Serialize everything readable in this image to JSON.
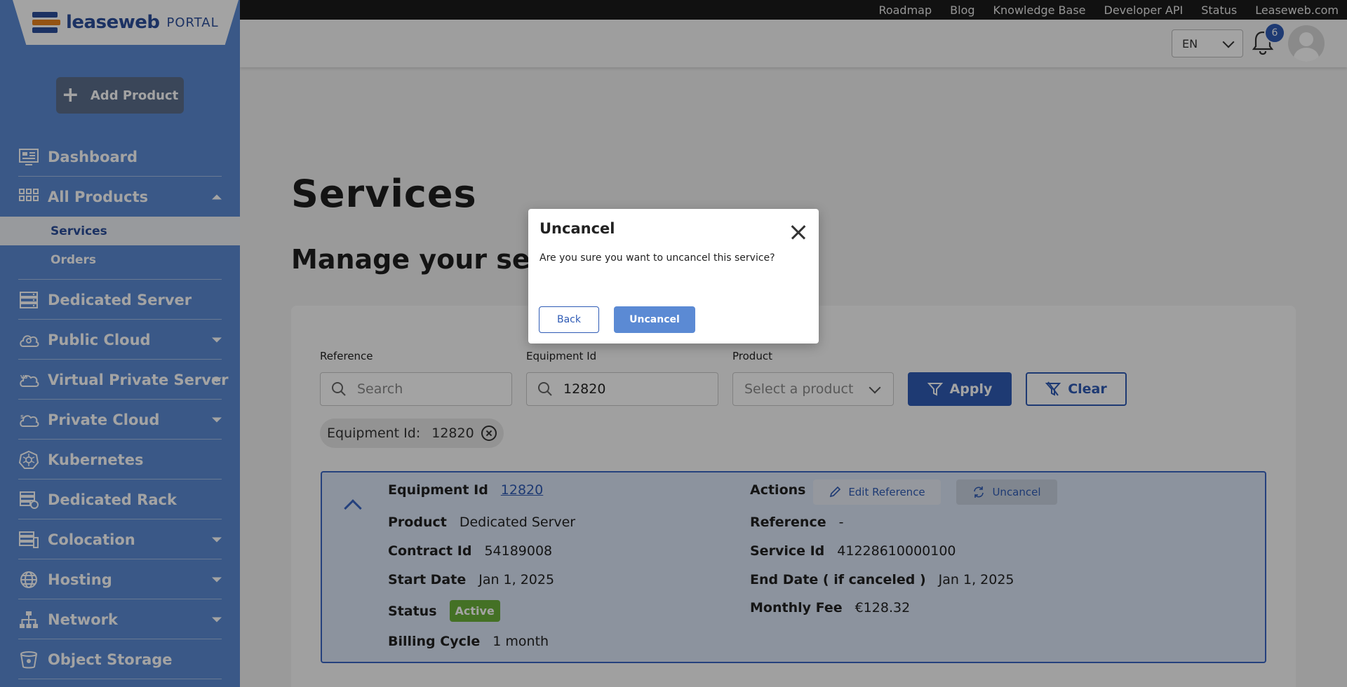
{
  "topnav": {
    "links": [
      "Roadmap",
      "Blog",
      "Knowledge Base",
      "Developer API",
      "Status",
      "Leaseweb.com"
    ]
  },
  "brand": {
    "name": "leaseweb",
    "portal": "PORTAL"
  },
  "sidebar": {
    "add_product": "Add Product",
    "items": [
      {
        "label": "Dashboard",
        "icon": "dashboard-icon"
      },
      {
        "label": "All Products",
        "icon": "grid-icon"
      },
      {
        "label": "Dedicated Server",
        "icon": "server-icon"
      },
      {
        "label": "Public Cloud",
        "icon": "cloud-user-icon"
      },
      {
        "label": "Virtual Private Server",
        "icon": "vps-cloud-icon"
      },
      {
        "label": "Private Cloud",
        "icon": "private-cloud-icon"
      },
      {
        "label": "Kubernetes",
        "icon": "kubernetes-icon"
      },
      {
        "label": "Dedicated Rack",
        "icon": "rack-icon"
      },
      {
        "label": "Colocation",
        "icon": "colocation-icon"
      },
      {
        "label": "Hosting",
        "icon": "globe-icon"
      },
      {
        "label": "Network",
        "icon": "network-icon"
      },
      {
        "label": "Object Storage",
        "icon": "bucket-icon"
      }
    ],
    "sub_items": [
      {
        "label": "Services",
        "active": true
      },
      {
        "label": "Orders",
        "active": false
      }
    ]
  },
  "header": {
    "lang": "EN",
    "notifications": "6"
  },
  "main": {
    "title": "Services",
    "subtitle": "Manage your servic"
  },
  "filters": {
    "reference_label": "Reference",
    "reference_placeholder": "Search",
    "equipment_label": "Equipment Id",
    "equipment_value": "12820",
    "product_label": "Product",
    "product_placeholder": "Select a product",
    "apply": "Apply",
    "clear": "Clear",
    "chip_key": "Equipment Id:",
    "chip_value": "12820"
  },
  "result": {
    "equipment_key": "Equipment Id",
    "equipment_value": "12820",
    "product_key": "Product",
    "product_value": "Dedicated Server",
    "contract_key": "Contract Id",
    "contract_value": "54189008",
    "start_key": "Start Date",
    "start_value": "Jan 1, 2025",
    "status_key": "Status",
    "status_value": "Active",
    "billing_key": "Billing Cycle",
    "billing_value": "1 month",
    "actions_key": "Actions",
    "edit_reference": "Edit Reference",
    "uncancel": "Uncancel",
    "reference_key": "Reference",
    "reference_value": "-",
    "service_key": "Service Id",
    "service_value": "41228610000100",
    "end_key": "End Date ( if canceled )",
    "end_value": "Jan 1, 2025",
    "fee_key": "Monthly Fee",
    "fee_value": "€128.32"
  },
  "modal": {
    "title": "Uncancel",
    "text": "Are you sure you want to uncancel this service?",
    "back": "Back",
    "confirm": "Uncancel"
  },
  "colors": {
    "sidebar": "#5b8ad4",
    "primary": "#2f5bb5",
    "status_active": "#6bb13a"
  }
}
